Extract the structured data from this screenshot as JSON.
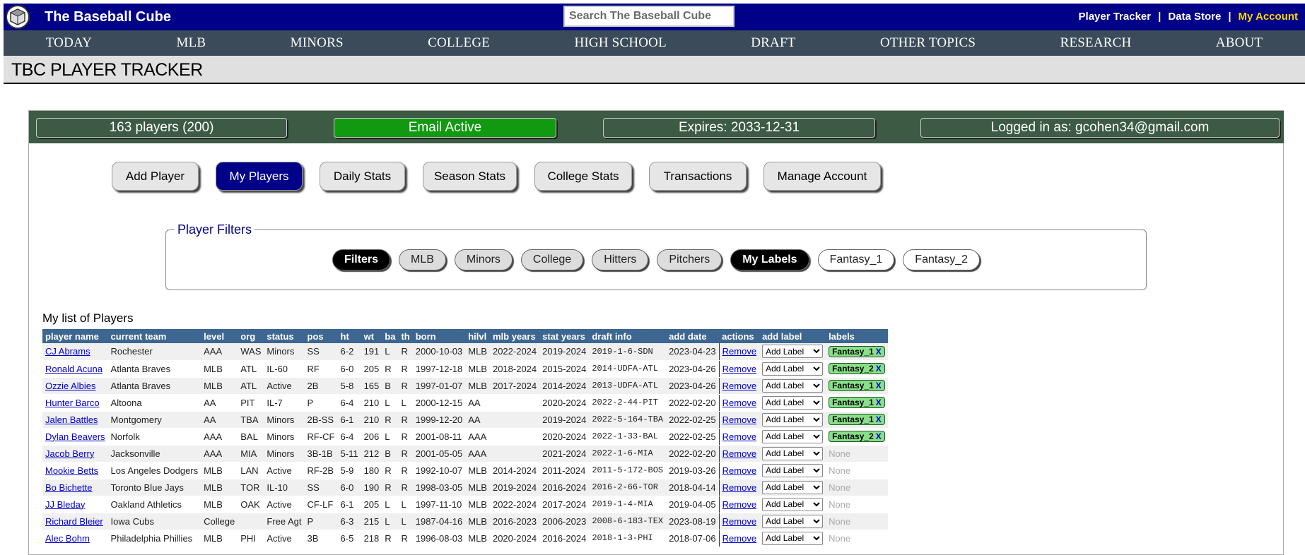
{
  "header": {
    "site_title": "The Baseball Cube",
    "search_placeholder": "Search The Baseball Cube",
    "links": [
      "Player Tracker",
      "Data Store",
      "My Account"
    ],
    "link_separator": "|"
  },
  "nav": [
    "TODAY",
    "MLB",
    "MINORS",
    "COLLEGE",
    "HIGH SCHOOL",
    "DRAFT",
    "OTHER TOPICS",
    "RESEARCH",
    "ABOUT"
  ],
  "page_title": "TBC PLAYER TRACKER",
  "status": {
    "players": "163 players (200)",
    "email": "Email Active",
    "expires": "Expires: 2033-12-31",
    "logged_in": "Logged in as: gcohen34@gmail.com"
  },
  "actions": [
    "Add Player",
    "My Players",
    "Daily Stats",
    "Season Stats",
    "College Stats",
    "Transactions",
    "Manage Account"
  ],
  "active_action": "My Players",
  "filters": {
    "legend": "Player Filters",
    "buttons": [
      "Filters",
      "MLB",
      "Minors",
      "College",
      "Hitters",
      "Pitchers",
      "My Labels",
      "Fantasy_1",
      "Fantasy_2"
    ]
  },
  "list_title": "My list of Players",
  "table": {
    "headers": [
      "player name",
      "current team",
      "level",
      "org",
      "status",
      "pos",
      "ht",
      "wt",
      "ba",
      "th",
      "born",
      "hilvl",
      "mlb years",
      "stat years",
      "draft info",
      "add date",
      "actions",
      "add label",
      "labels"
    ],
    "remove_label": "Remove",
    "add_label_select": "Add Label",
    "none_label": "None",
    "label_remove": "X",
    "rows": [
      [
        "CJ Abrams",
        "Rochester",
        "AAA",
        "WAS",
        "Minors",
        "SS",
        "6-2",
        "191",
        "L",
        "R",
        "2000-10-03",
        "MLB",
        "2022-2024",
        "2019-2024",
        "2019-1-6-SDN",
        "2023-04-23",
        "Fantasy_1"
      ],
      [
        "Ronald Acuna",
        "Atlanta Braves",
        "MLB",
        "ATL",
        "IL-60",
        "RF",
        "6-0",
        "205",
        "R",
        "R",
        "1997-12-18",
        "MLB",
        "2018-2024",
        "2015-2024",
        "2014-UDFA-ATL",
        "2023-04-26",
        "Fantasy_2"
      ],
      [
        "Ozzie Albies",
        "Atlanta Braves",
        "MLB",
        "ATL",
        "Active",
        "2B",
        "5-8",
        "165",
        "B",
        "R",
        "1997-01-07",
        "MLB",
        "2017-2024",
        "2014-2024",
        "2013-UDFA-ATL",
        "2023-04-26",
        "Fantasy_1"
      ],
      [
        "Hunter Barco",
        "Altoona",
        "AA",
        "PIT",
        "IL-7",
        "P",
        "6-4",
        "210",
        "L",
        "L",
        "2000-12-15",
        "AA",
        "",
        "2020-2024",
        "2022-2-44-PIT",
        "2022-02-20",
        "Fantasy_1"
      ],
      [
        "Jalen Battles",
        "Montgomery",
        "AA",
        "TBA",
        "Minors",
        "2B-SS",
        "6-1",
        "210",
        "R",
        "R",
        "1999-12-20",
        "AA",
        "",
        "2019-2024",
        "2022-5-164-TBA",
        "2022-02-25",
        "Fantasy_1"
      ],
      [
        "Dylan Beavers",
        "Norfolk",
        "AAA",
        "BAL",
        "Minors",
        "RF-CF",
        "6-4",
        "206",
        "L",
        "R",
        "2001-08-11",
        "AAA",
        "",
        "2020-2024",
        "2022-1-33-BAL",
        "2022-02-25",
        "Fantasy_2"
      ],
      [
        "Jacob Berry",
        "Jacksonville",
        "AAA",
        "MIA",
        "Minors",
        "3B-1B",
        "5-11",
        "212",
        "B",
        "R",
        "2001-05-05",
        "AAA",
        "",
        "2021-2024",
        "2022-1-6-MIA",
        "2022-02-20",
        ""
      ],
      [
        "Mookie Betts",
        "Los Angeles Dodgers",
        "MLB",
        "LAN",
        "Active",
        "RF-2B",
        "5-9",
        "180",
        "R",
        "R",
        "1992-10-07",
        "MLB",
        "2014-2024",
        "2011-2024",
        "2011-5-172-BOS",
        "2019-03-26",
        ""
      ],
      [
        "Bo Bichette",
        "Toronto Blue Jays",
        "MLB",
        "TOR",
        "IL-10",
        "SS",
        "6-0",
        "190",
        "R",
        "R",
        "1998-03-05",
        "MLB",
        "2019-2024",
        "2016-2024",
        "2016-2-66-TOR",
        "2018-04-14",
        ""
      ],
      [
        "JJ Bleday",
        "Oakland Athletics",
        "MLB",
        "OAK",
        "Active",
        "CF-LF",
        "6-1",
        "205",
        "L",
        "L",
        "1997-11-10",
        "MLB",
        "2022-2024",
        "2017-2024",
        "2019-1-4-MIA",
        "2019-04-05",
        ""
      ],
      [
        "Richard Bleier",
        "Iowa Cubs",
        "College",
        "",
        "Free Agt",
        "P",
        "6-3",
        "215",
        "L",
        "L",
        "1987-04-16",
        "MLB",
        "2016-2023",
        "2006-2023",
        "2008-6-183-TEX",
        "2023-08-19",
        ""
      ],
      [
        "Alec Bohm",
        "Philadelphia Phillies",
        "MLB",
        "PHI",
        "Active",
        "3B",
        "6-5",
        "218",
        "R",
        "R",
        "1996-08-03",
        "MLB",
        "2020-2024",
        "2016-2024",
        "2018-1-3-PHI",
        "2018-07-06",
        ""
      ]
    ]
  }
}
